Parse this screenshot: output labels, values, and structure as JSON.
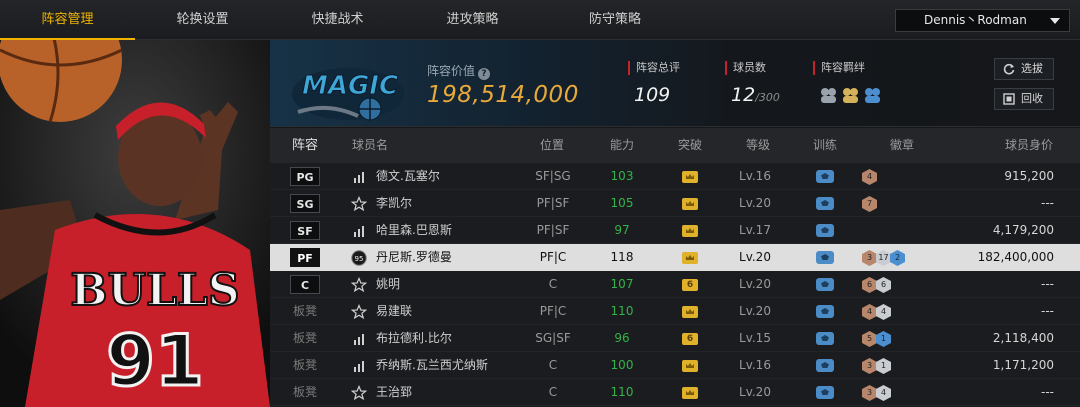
{
  "nav": {
    "tabs": [
      {
        "label": "阵容管理",
        "active": true
      },
      {
        "label": "轮换设置",
        "active": false
      },
      {
        "label": "快捷战术",
        "active": false
      },
      {
        "label": "进攻策略",
        "active": false
      },
      {
        "label": "防守策略",
        "active": false
      }
    ],
    "player_select": "Dennis丶Rodman"
  },
  "header": {
    "team_logo": "orlando-magic-logo",
    "value_label": "阵容价值",
    "value": "198,514,000",
    "rating_label": "阵容总评",
    "rating": "109",
    "count_label": "球员数",
    "count": "12",
    "count_max": "/300",
    "bond_label": "阵容羁绊",
    "buttons": {
      "pick": "选拔",
      "recall": "回收"
    }
  },
  "table": {
    "headers": [
      "阵容",
      "球员名",
      "位置",
      "能力",
      "突破",
      "等级",
      "训练",
      "徽章",
      "球员身价"
    ],
    "rows": [
      {
        "slot": "PG",
        "starter": true,
        "icon": "bars-icon",
        "name": "德文.瓦塞尔",
        "position": "SF|SG",
        "ability": "103",
        "breakthrough": "",
        "level": "Lv.16",
        "badges": [
          {
            "t": "bronze",
            "v": "4"
          }
        ],
        "price": "915,200"
      },
      {
        "slot": "SG",
        "starter": true,
        "icon": "star-icon",
        "name": "李凯尔",
        "position": "PF|SF",
        "ability": "105",
        "breakthrough": "",
        "level": "Lv.20",
        "badges": [
          {
            "t": "bronze",
            "v": "7"
          }
        ],
        "price": "---"
      },
      {
        "slot": "SF",
        "starter": true,
        "icon": "bars-icon",
        "name": "哈里森.巴恩斯",
        "position": "PF|SF",
        "ability": "97",
        "breakthrough": "",
        "level": "Lv.17",
        "badges": [],
        "price": "4,179,200"
      },
      {
        "slot": "PF",
        "starter": true,
        "selected": true,
        "icon": "rating-95-icon",
        "name": "丹尼斯.罗德曼",
        "position": "PF|C",
        "ability": "118",
        "breakthrough": "",
        "level": "Lv.20",
        "badges": [
          {
            "t": "bronze",
            "v": "3"
          },
          {
            "t": "silver",
            "v": "17"
          },
          {
            "t": "gold",
            "v": "2"
          }
        ],
        "price": "182,400,000"
      },
      {
        "slot": "C",
        "starter": true,
        "icon": "star-icon",
        "name": "姚明",
        "position": "C",
        "ability": "107",
        "breakthrough": "6",
        "level": "Lv.20",
        "badges": [
          {
            "t": "bronze",
            "v": "6"
          },
          {
            "t": "silver",
            "v": "6"
          }
        ],
        "price": "---"
      },
      {
        "slot": "板凳",
        "starter": false,
        "icon": "star-icon",
        "name": "易建联",
        "position": "PF|C",
        "ability": "110",
        "breakthrough": "",
        "level": "Lv.20",
        "badges": [
          {
            "t": "bronze",
            "v": "4"
          },
          {
            "t": "silver",
            "v": "4"
          }
        ],
        "price": "---"
      },
      {
        "slot": "板凳",
        "starter": false,
        "icon": "bars-icon",
        "name": "布拉德利.比尔",
        "position": "SG|SF",
        "ability": "96",
        "breakthrough": "6",
        "level": "Lv.15",
        "badges": [
          {
            "t": "bronze",
            "v": "5"
          },
          {
            "t": "gold",
            "v": "1"
          }
        ],
        "price": "2,118,400"
      },
      {
        "slot": "板凳",
        "starter": false,
        "icon": "bars-icon",
        "name": "乔纳斯.瓦兰西尤纳斯",
        "position": "C",
        "ability": "100",
        "breakthrough": "",
        "level": "Lv.16",
        "badges": [
          {
            "t": "bronze",
            "v": "3"
          },
          {
            "t": "silver",
            "v": "1"
          }
        ],
        "price": "1,171,200"
      },
      {
        "slot": "板凳",
        "starter": false,
        "icon": "star-icon",
        "name": "王治郅",
        "position": "C",
        "ability": "110",
        "breakthrough": "",
        "level": "Lv.20",
        "badges": [
          {
            "t": "bronze",
            "v": "3"
          },
          {
            "t": "silver",
            "v": "4"
          }
        ],
        "price": "---"
      }
    ]
  },
  "colors": {
    "accent": "#f0b400",
    "value": "#e8a93a",
    "ability_green": "#36b24a",
    "stat_red": "#c2242b"
  }
}
